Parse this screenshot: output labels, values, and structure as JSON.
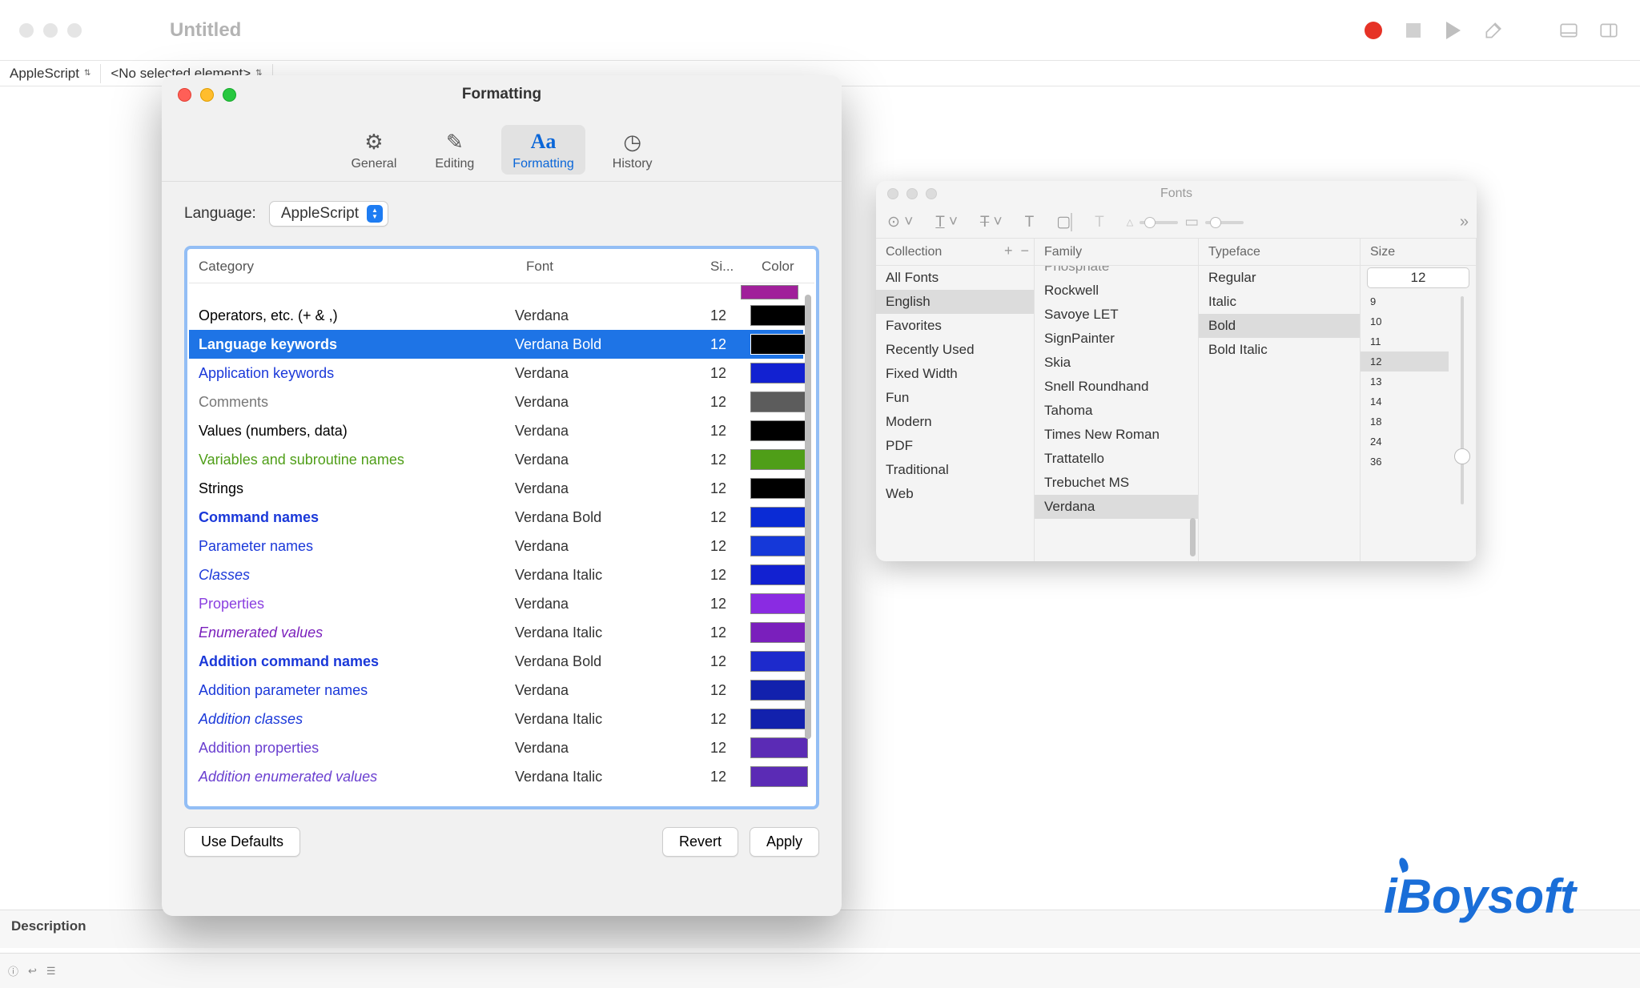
{
  "main_window": {
    "title": "Untitled",
    "sub_toolbar": {
      "language": "AppleScript",
      "element_selector": "<No selected element>"
    },
    "status_label": "Description"
  },
  "pref_window": {
    "title": "Formatting",
    "tabs": {
      "general": "General",
      "editing": "Editing",
      "formatting": "Formatting",
      "history": "History"
    },
    "language_label": "Language:",
    "language_value": "AppleScript",
    "columns": {
      "category": "Category",
      "font": "Font",
      "size": "Si...",
      "color": "Color"
    },
    "rows": [
      {
        "category": "Operators, etc. (+ & ,)",
        "font": "Verdana",
        "size": "12",
        "color": "#000000",
        "text_color": "#000000",
        "bold": false,
        "italic": false,
        "selected": false
      },
      {
        "category": "Language keywords",
        "font": "Verdana Bold",
        "size": "12",
        "color": "#000000",
        "text_color": "#ffffff",
        "bold": true,
        "italic": false,
        "selected": true
      },
      {
        "category": "Application keywords",
        "font": "Verdana",
        "size": "12",
        "color": "#1221d1",
        "text_color": "#1a38d9",
        "bold": false,
        "italic": false,
        "selected": false
      },
      {
        "category": "Comments",
        "font": "Verdana",
        "size": "12",
        "color": "#5c5c5c",
        "text_color": "#777777",
        "bold": false,
        "italic": false,
        "selected": false
      },
      {
        "category": "Values (numbers, data)",
        "font": "Verdana",
        "size": "12",
        "color": "#000000",
        "text_color": "#000000",
        "bold": false,
        "italic": false,
        "selected": false
      },
      {
        "category": "Variables and subroutine names",
        "font": "Verdana",
        "size": "12",
        "color": "#4f9e18",
        "text_color": "#4f9e18",
        "bold": false,
        "italic": false,
        "selected": false
      },
      {
        "category": "Strings",
        "font": "Verdana",
        "size": "12",
        "color": "#000000",
        "text_color": "#000000",
        "bold": false,
        "italic": false,
        "selected": false
      },
      {
        "category": "Command names",
        "font": "Verdana Bold",
        "size": "12",
        "color": "#0a2bd5",
        "text_color": "#1a38d9",
        "bold": true,
        "italic": false,
        "selected": false
      },
      {
        "category": "Parameter names",
        "font": "Verdana",
        "size": "12",
        "color": "#1538d9",
        "text_color": "#1a38d9",
        "bold": false,
        "italic": false,
        "selected": false
      },
      {
        "category": "Classes",
        "font": "Verdana Italic",
        "size": "12",
        "color": "#1221d1",
        "text_color": "#1a38d9",
        "bold": false,
        "italic": true,
        "selected": false
      },
      {
        "category": "Properties",
        "font": "Verdana",
        "size": "12",
        "color": "#8a2be2",
        "text_color": "#8a3fe0",
        "bold": false,
        "italic": false,
        "selected": false
      },
      {
        "category": "Enumerated values",
        "font": "Verdana Italic",
        "size": "12",
        "color": "#7a1fbc",
        "text_color": "#7a1fbc",
        "bold": false,
        "italic": true,
        "selected": false
      },
      {
        "category": "Addition command names",
        "font": "Verdana Bold",
        "size": "12",
        "color": "#1d2acc",
        "text_color": "#1a38d9",
        "bold": true,
        "italic": false,
        "selected": false
      },
      {
        "category": "Addition parameter names",
        "font": "Verdana",
        "size": "12",
        "color": "#1221ad",
        "text_color": "#1a38d9",
        "bold": false,
        "italic": false,
        "selected": false
      },
      {
        "category": "Addition classes",
        "font": "Verdana Italic",
        "size": "12",
        "color": "#1221ad",
        "text_color": "#1a38d9",
        "bold": false,
        "italic": true,
        "selected": false
      },
      {
        "category": "Addition properties",
        "font": "Verdana",
        "size": "12",
        "color": "#5b2bb5",
        "text_color": "#6a3fd0",
        "bold": false,
        "italic": false,
        "selected": false
      },
      {
        "category": "Addition enumerated values",
        "font": "Verdana Italic",
        "size": "12",
        "color": "#5b2bb5",
        "text_color": "#6a3fd0",
        "bold": false,
        "italic": true,
        "selected": false
      }
    ],
    "purple_bar_color": "#a0209a",
    "buttons": {
      "use_defaults": "Use Defaults",
      "revert": "Revert",
      "apply": "Apply"
    }
  },
  "fonts_panel": {
    "title": "Fonts",
    "columns": {
      "collection": "Collection",
      "family": "Family",
      "typeface": "Typeface",
      "size": "Size"
    },
    "size_value": "12",
    "collections": [
      {
        "label": "All Fonts",
        "selected": false
      },
      {
        "label": "English",
        "selected": true
      },
      {
        "label": "Favorites",
        "selected": false
      },
      {
        "label": "Recently Used",
        "selected": false
      },
      {
        "label": "Fixed Width",
        "selected": false
      },
      {
        "label": "Fun",
        "selected": false
      },
      {
        "label": "Modern",
        "selected": false
      },
      {
        "label": "PDF",
        "selected": false
      },
      {
        "label": "Traditional",
        "selected": false
      },
      {
        "label": "Web",
        "selected": false
      }
    ],
    "families": [
      {
        "label": "Phosphate",
        "selected": false
      },
      {
        "label": "Rockwell",
        "selected": false
      },
      {
        "label": "Savoye LET",
        "selected": false
      },
      {
        "label": "SignPainter",
        "selected": false
      },
      {
        "label": "Skia",
        "selected": false
      },
      {
        "label": "Snell Roundhand",
        "selected": false
      },
      {
        "label": "Tahoma",
        "selected": false
      },
      {
        "label": "Times New Roman",
        "selected": false
      },
      {
        "label": "Trattatello",
        "selected": false
      },
      {
        "label": "Trebuchet MS",
        "selected": false
      },
      {
        "label": "Verdana",
        "selected": true
      }
    ],
    "typefaces": [
      {
        "label": "Regular",
        "selected": false
      },
      {
        "label": "Italic",
        "selected": false
      },
      {
        "label": "Bold",
        "selected": true
      },
      {
        "label": "Bold Italic",
        "selected": false
      }
    ],
    "sizes": [
      {
        "label": "9",
        "selected": false
      },
      {
        "label": "10",
        "selected": false
      },
      {
        "label": "11",
        "selected": false
      },
      {
        "label": "12",
        "selected": true
      },
      {
        "label": "13",
        "selected": false
      },
      {
        "label": "14",
        "selected": false
      },
      {
        "label": "18",
        "selected": false
      },
      {
        "label": "24",
        "selected": false
      },
      {
        "label": "36",
        "selected": false
      }
    ]
  },
  "watermark": "iBoysoft"
}
